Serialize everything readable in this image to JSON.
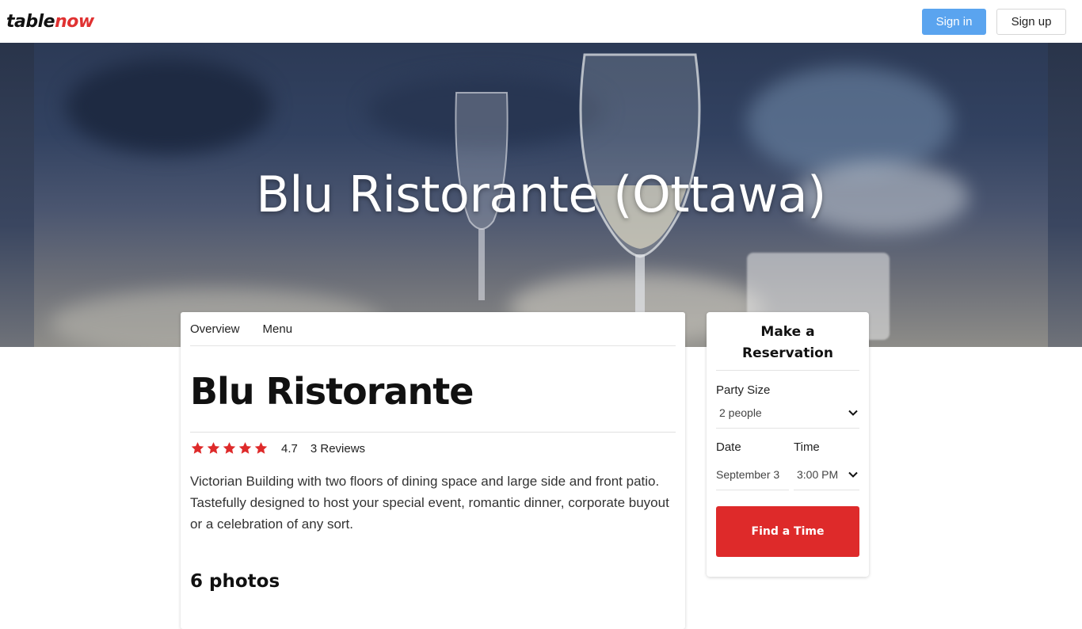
{
  "navbar": {
    "logo_part1": "table",
    "logo_part2": "now",
    "signin_label": "Sign in",
    "signup_label": "Sign up"
  },
  "hero": {
    "title": "Blu Ristorante (Ottawa)"
  },
  "tabs": [
    {
      "label": "Overview"
    },
    {
      "label": "Menu"
    }
  ],
  "restaurant": {
    "name": "Blu Ristorante",
    "rating": "4.7",
    "stars_filled": 5,
    "reviews_label": "3 Reviews",
    "description": "Victorian Building with two floors of dining space and large side and front patio. Tastefully designed to host your special event, romantic dinner, corporate buyout or a celebration of any sort.",
    "photos_title": "6 photos"
  },
  "reservation": {
    "title": "Make a Reservation",
    "party_size_label": "Party Size",
    "party_size_value": "2 people",
    "date_label": "Date",
    "date_value": "September 3",
    "time_label": "Time",
    "time_value": "3:00 PM",
    "find_label": "Find a Time"
  },
  "colors": {
    "brand_red": "#e03131",
    "signin_blue": "#5aa4ef",
    "find_button": "#de2a2a",
    "star": "#de2a2a"
  }
}
